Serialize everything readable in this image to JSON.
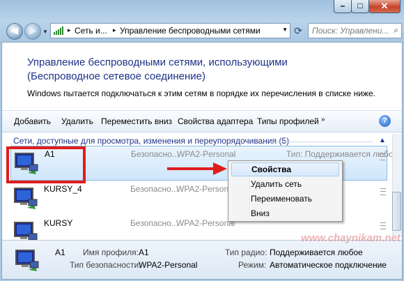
{
  "nav": {
    "address": {
      "crumb1": "Сеть и...",
      "sep1": "▸",
      "crumb2": "Управление беспроводными сетями",
      "sep0": "▸"
    },
    "search_placeholder": "Поиск: Управлени...",
    "back_glyph": "◀",
    "forward_glyph": "▶"
  },
  "window_controls": {
    "minimize": "–",
    "maximize": "□",
    "close": "✕"
  },
  "page": {
    "title": "Управление беспроводными сетями, использующими (Беспроводное сетевое соединение)",
    "description": "Windows пытается подключаться к этим сетям в порядке их перечисления в списке ниже."
  },
  "toolbar": {
    "add": "Добавить",
    "remove": "Удалить",
    "move_down": "Переместить вниз",
    "adapter_props": "Свойства адаптера",
    "profile_types": "Типы профилей",
    "more": "»",
    "help": "?"
  },
  "group_header": "Сети, доступные для просмотра, изменения и переупорядочивания (5)",
  "networks": [
    {
      "name": "A1",
      "security": "Безопасно...",
      "auth": "WPA2-Personal",
      "type": "Тип: Поддерживается любое"
    },
    {
      "name": "KURSY_4",
      "security": "Безопасно...",
      "auth": "WPA2-Personal",
      "type": ""
    },
    {
      "name": "KURSY",
      "security": "Безопасно...",
      "auth": "WPA2-Personal",
      "type": ""
    }
  ],
  "context_menu": {
    "items": [
      "Свойства",
      "Удалить сеть",
      "Переименовать",
      "Вниз"
    ]
  },
  "details": {
    "name": "A1",
    "profile_label": "Имя профиля:",
    "profile_value": "A1",
    "security_label": "Тип безопасности:",
    "security_value": "WPA2-Personal",
    "radio_label": "Тип радио:",
    "radio_value": "Поддерживается любое",
    "mode_label": "Режим:",
    "mode_value": "Автоматическое подключение"
  },
  "watermark": "www.chaynikam.net",
  "colors": {
    "title": "#1e3287",
    "highlight_box": "#e01d1d",
    "arrow": "#e01d1d"
  }
}
